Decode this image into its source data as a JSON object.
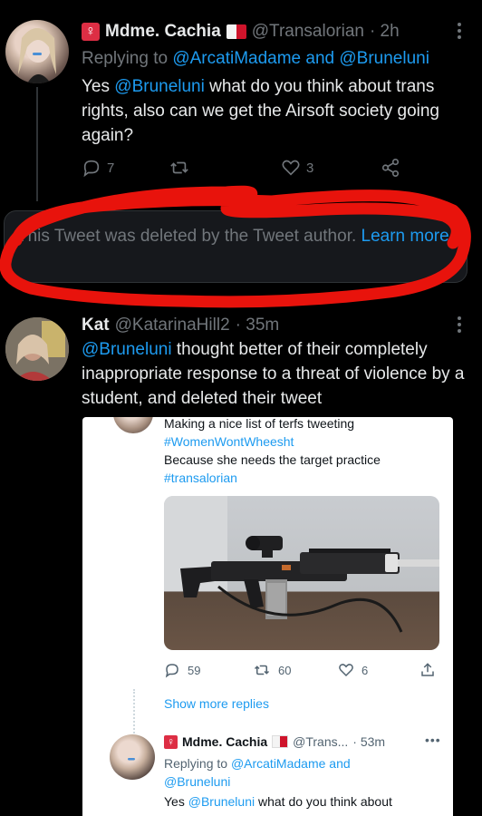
{
  "tweet1": {
    "name": "Mdme. Cachia",
    "handle": "@Transalorian",
    "time": "· 2h",
    "replying_prefix": "Replying to",
    "replying_to": "@ArcatiMadame and @Bruneluni",
    "text_pre": "Yes ",
    "mention": "@Bruneluni",
    "text_post": " what do you think about trans rights, also can we get the Airsoft society going again?",
    "reply_count": "7",
    "retweet_count": "",
    "like_count": "3"
  },
  "deleted": {
    "text": "This Tweet was deleted by the Tweet author.",
    "learn_more": "Learn more"
  },
  "tweet2": {
    "name": "Kat",
    "handle": "@KatarinaHill2",
    "time": "· 35m",
    "mention": "@Bruneluni",
    "text_post": " thought better of their completely inappropriate response to a threat of violence by a student, and deleted their tweet"
  },
  "embed": {
    "line1": "Making a nice list of terfs tweeting",
    "hashtag1": "#WomenWontWheesht",
    "line2": "Because she needs the target practice",
    "hashtag2": "#transalorian",
    "reply_count": "59",
    "retweet_count": "60",
    "like_count": "6",
    "show_more": "Show more replies",
    "reply_name": "Mdme. Cachia",
    "reply_handle": "@Trans...",
    "reply_time": "· 53m",
    "reply_replying_prefix": "Replying to",
    "reply_replying_to": "@ArcatiMadame and",
    "reply_replying_to2": "@Bruneluni",
    "reply_text_pre": "Yes ",
    "reply_mention": "@Bruneluni",
    "reply_text_post": " what do you think about"
  },
  "colors": {
    "background": "#000000",
    "accent": "#1d9bf0",
    "muted": "#71767b",
    "scribble": "#e8130c"
  }
}
